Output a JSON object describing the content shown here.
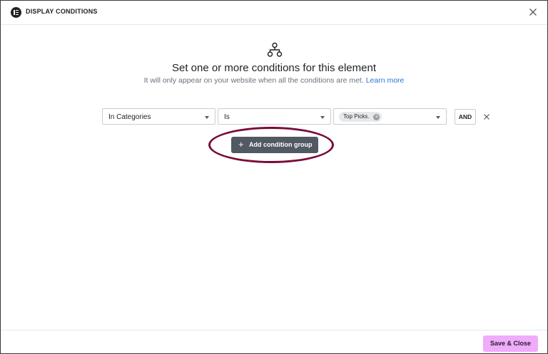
{
  "dialog": {
    "title": "DISPLAY CONDITIONS",
    "icons": {
      "logo": "elementor-logo-icon",
      "close": "close-icon",
      "header": "sitemap-icon"
    }
  },
  "intro": {
    "heading": "Set one or more conditions for this element",
    "subtitle": "It will only appear on your website when all the conditions are met.",
    "learn_more": "Learn more"
  },
  "condition_row": {
    "condition": "In Categories",
    "operator": "Is",
    "values": [
      "Top Picks."
    ],
    "logic": "AND"
  },
  "actions": {
    "add_group": "Add condition group",
    "save_close": "Save & Close"
  },
  "colors": {
    "save_button": "#f0abfc",
    "add_group_button": "#515962",
    "highlight_ring": "#7a0a3a",
    "link": "#2a77d6"
  }
}
